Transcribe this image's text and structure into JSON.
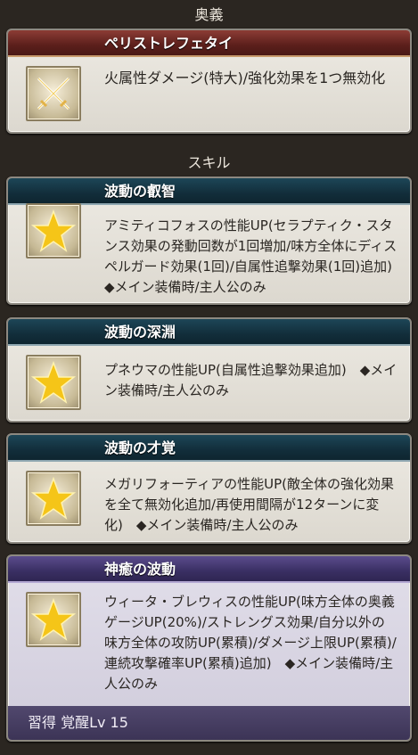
{
  "ougi_header": "奥義",
  "ougi": {
    "title": "ペリストレフェタイ",
    "description": "火属性ダメージ(特大)/強化効果を1つ無効化",
    "icon": "crossed-swords-icon"
  },
  "skill_header": "スキル",
  "skills": [
    {
      "title": "波動の叡智",
      "description": "アミティコフォスの性能UP(セラプティク・スタンス効果の発動回数が1回増加/味方全体にディスペルガード効果(1回)/自属性追撃効果(1回)追加)　◆メイン装備時/主人公のみ",
      "icon": "star-icon"
    },
    {
      "title": "波動の深淵",
      "description": "プネウマの性能UP(自属性追撃効果追加)　◆メイン装備時/主人公のみ",
      "icon": "star-icon"
    },
    {
      "title": "波動の才覚",
      "description": "メガリフォーティアの性能UP(敵全体の強化効果を全て無効化追加/再使用間隔が12ターンに変化)　◆メイン装備時/主人公のみ",
      "icon": "star-icon"
    },
    {
      "title": "神癒の波動",
      "description": "ウィータ・ブレウィスの性能UP(味方全体の奥義ゲージUP(20%)/ストレングス効果/自分以外の味方全体の攻防UP(累積)/ダメージ上限UP(累積)/連続攻撃確率UP(累積)追加)　◆メイン装備時/主人公のみ",
      "icon": "star-icon",
      "footer": "習得 覚醒Lv 15"
    }
  ],
  "colors": {
    "ougi_title_bg": "#5b1f1b",
    "skill_title_bg": "#122e3b",
    "special_title_bg": "#3a2f63",
    "background": "#2b2621"
  }
}
